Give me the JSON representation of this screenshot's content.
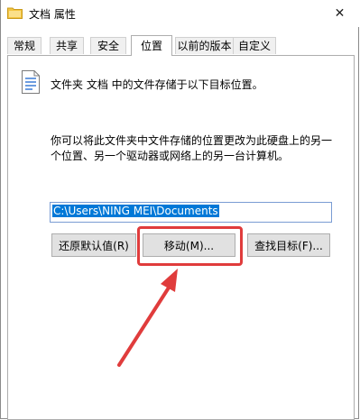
{
  "window": {
    "title": "文档 属性"
  },
  "tabs": [
    {
      "label": "常规"
    },
    {
      "label": "共享"
    },
    {
      "label": "安全"
    },
    {
      "label": "位置",
      "active": true
    },
    {
      "label": "以前的版本"
    },
    {
      "label": "自定义"
    }
  ],
  "location": {
    "description": "文件夹 文档 中的文件存储于以下目标位置。",
    "info": "你可以将此文件夹中文件存储的位置更改为此硬盘上的另一个位置、另一个驱动器或网络上的另一台计算机。",
    "path_value": "C:\\Users\\NING MEI\\Documents"
  },
  "buttons": {
    "restore_default": "还原默认值(R)",
    "move": "移动(M)...",
    "find_target": "查找目标(F)..."
  },
  "annotation": {
    "color": "#e03c3c"
  }
}
